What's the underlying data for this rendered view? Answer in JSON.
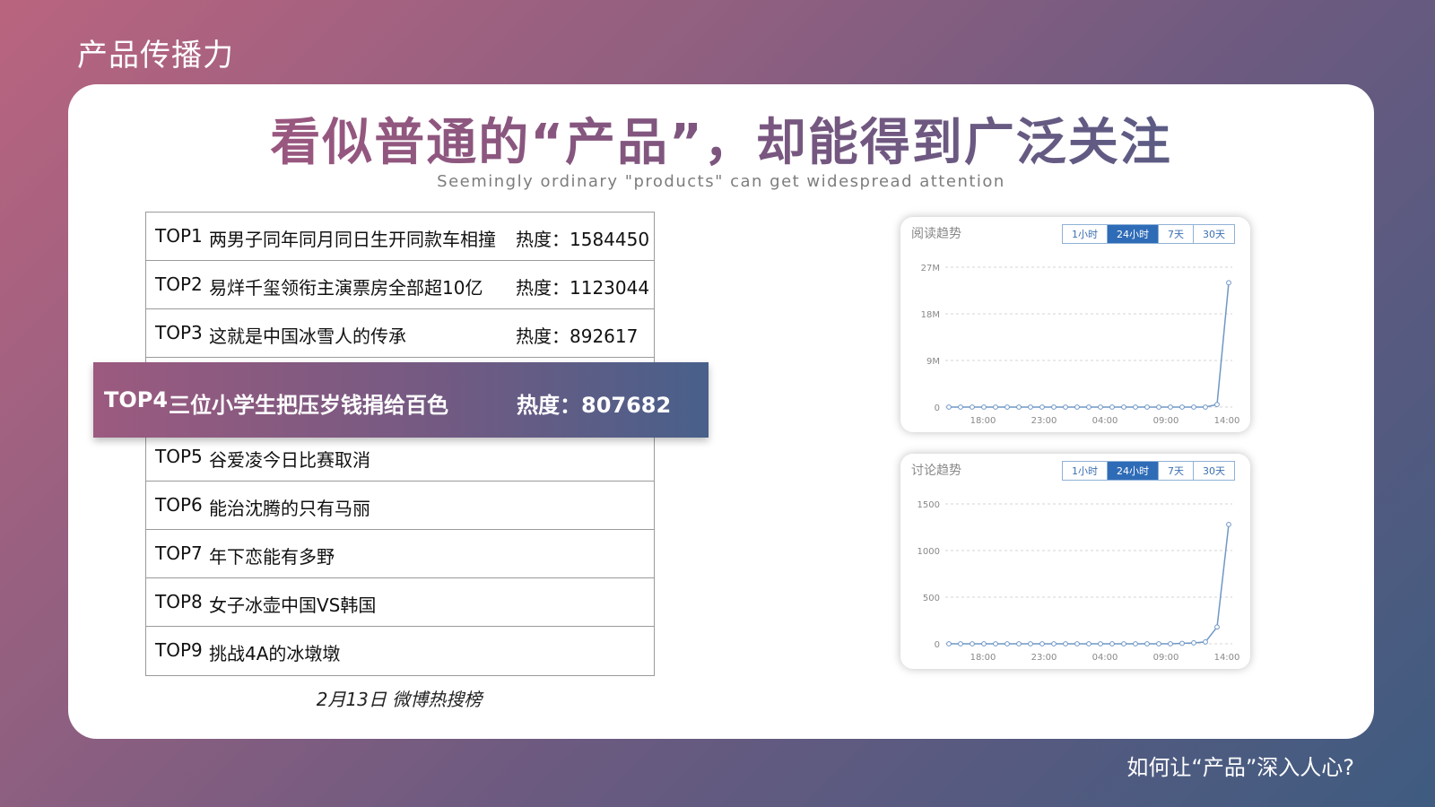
{
  "slide_title": "产品传播力",
  "footer": "如何让“产品”深入人心?",
  "headline": "看似普通的“产品”，却能得到广泛关注",
  "subtitle": "Seemingly ordinary \"products\" can get widespread attention",
  "ranking": [
    {
      "rank": "TOP1",
      "title": "两男子同年同月同日生开同款车相撞",
      "heat": "热度：1584450"
    },
    {
      "rank": "TOP2",
      "title": "易烊千玺领衔主演票房全部超10亿",
      "heat": "热度：1123044"
    },
    {
      "rank": "TOP3",
      "title": "这就是中国冰雪人的传承",
      "heat": "热度：892617"
    },
    {
      "rank": "TOP4",
      "title": "三位小学生把压岁钱捐给百色",
      "heat": "热度：807682"
    },
    {
      "rank": "TOP5",
      "title": "谷爱凌今日比赛取消",
      "heat": ""
    },
    {
      "rank": "TOP6",
      "title": "能治沈腾的只有马丽",
      "heat": ""
    },
    {
      "rank": "TOP7",
      "title": "年下恋能有多野",
      "heat": ""
    },
    {
      "rank": "TOP8",
      "title": "女子冰壶中国VS韩国",
      "heat": ""
    },
    {
      "rank": "TOP9",
      "title": "挑战4A的冰墩墩",
      "heat": ""
    }
  ],
  "caption": "2月13日 微博热搜榜",
  "tabs": [
    "1小时",
    "24小时",
    "7天",
    "30天"
  ],
  "active_tab": "24小时",
  "accent_color": "#2f6cb7",
  "chart_data": [
    {
      "type": "line",
      "title": "阅读趋势",
      "x_ticks": [
        "18:00",
        "23:00",
        "04:00",
        "09:00",
        "14:00"
      ],
      "y_ticks": [
        "0",
        "9M",
        "18M",
        "27M"
      ],
      "ylim": [
        0,
        27000000
      ],
      "values": [
        0,
        0,
        0,
        0,
        0,
        0,
        0,
        0,
        0,
        0,
        0,
        0,
        0,
        0,
        0,
        0,
        0,
        0,
        0,
        0,
        0,
        0,
        0,
        500000,
        24000000
      ],
      "grid": true
    },
    {
      "type": "line",
      "title": "讨论趋势",
      "x_ticks": [
        "18:00",
        "23:00",
        "04:00",
        "09:00",
        "14:00"
      ],
      "y_ticks": [
        "0",
        "500",
        "1000",
        "1500"
      ],
      "ylim": [
        0,
        1500
      ],
      "values": [
        0,
        0,
        0,
        0,
        0,
        0,
        0,
        0,
        0,
        0,
        0,
        0,
        0,
        0,
        0,
        0,
        0,
        0,
        0,
        0,
        5,
        10,
        20,
        180,
        1280
      ],
      "grid": true
    }
  ]
}
